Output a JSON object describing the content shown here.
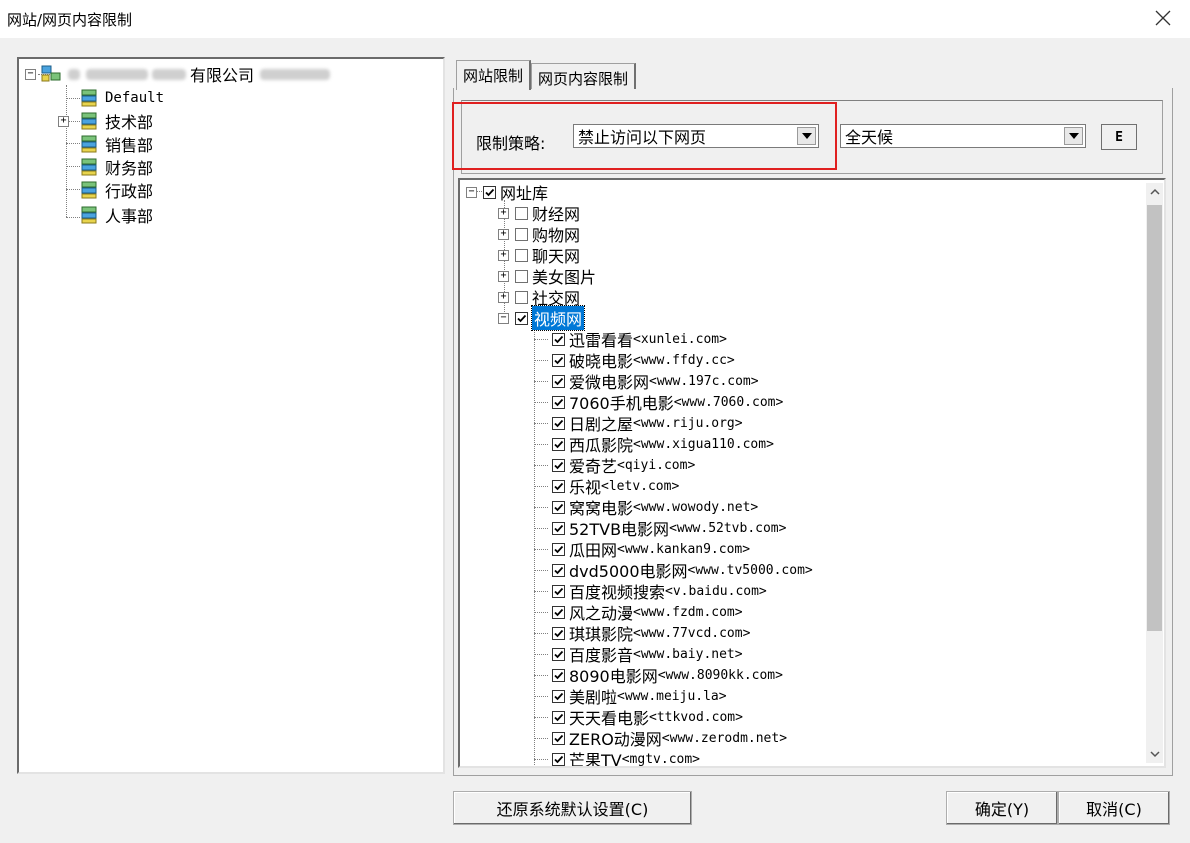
{
  "window": {
    "title": "网站/网页内容限制"
  },
  "org_tree": {
    "root_label_visible": "有限公司",
    "children": [
      "Default",
      "技术部",
      "销售部",
      "财务部",
      "行政部",
      "人事部"
    ]
  },
  "tabs": [
    "网站限制",
    "网页内容限制"
  ],
  "policy": {
    "label": "限制策略:",
    "selected": "禁止访问以下网页",
    "time_selected": "全天候",
    "e_button": "E"
  },
  "url_tree": {
    "root": "网址库",
    "categories": [
      "财经网",
      "购物网",
      "聊天网",
      "美女图片",
      "社交网"
    ],
    "expanded_category": "视频网",
    "sites": [
      {
        "name": "迅雷看看",
        "url": "<xunlei.com>"
      },
      {
        "name": "破晓电影",
        "url": "<www.ffdy.cc>"
      },
      {
        "name": "爱微电影网",
        "url": "<www.197c.com>"
      },
      {
        "name": "7060手机电影",
        "url": "<www.7060.com>"
      },
      {
        "name": "日剧之屋",
        "url": "<www.riju.org>"
      },
      {
        "name": "西瓜影院",
        "url": "<www.xigua110.com>"
      },
      {
        "name": "爱奇艺",
        "url": "<qiyi.com>"
      },
      {
        "name": "乐视",
        "url": "<letv.com>"
      },
      {
        "name": "窝窝电影",
        "url": "<www.wowody.net>"
      },
      {
        "name": "52TVB电影网",
        "url": "<www.52tvb.com>"
      },
      {
        "name": "瓜田网",
        "url": "<www.kankan9.com>"
      },
      {
        "name": "dvd5000电影网",
        "url": "<www.tv5000.com>"
      },
      {
        "name": "百度视频搜索",
        "url": "<v.baidu.com>"
      },
      {
        "name": "风之动漫",
        "url": "<www.fzdm.com>"
      },
      {
        "name": "琪琪影院",
        "url": "<www.77vcd.com>"
      },
      {
        "name": "百度影音",
        "url": "<www.baiy.net>"
      },
      {
        "name": "8090电影网",
        "url": "<www.8090kk.com>"
      },
      {
        "name": "美剧啦",
        "url": "<www.meiju.la>"
      },
      {
        "name": "天天看电影",
        "url": "<ttkvod.com>"
      },
      {
        "name": "ZERO动漫网",
        "url": "<www.zerodm.net>"
      },
      {
        "name": "芒果TV",
        "url": "<mgtv.com>"
      }
    ]
  },
  "buttons": {
    "restore": "还原系统默认设置(C)",
    "ok": "确定(Y)",
    "cancel": "取消(C)"
  }
}
